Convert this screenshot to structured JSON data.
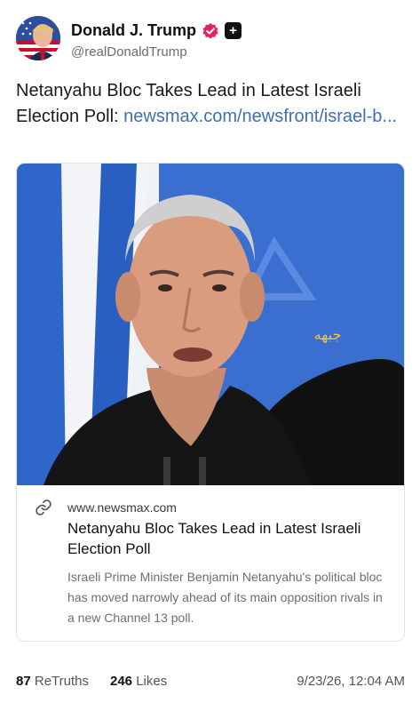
{
  "author": {
    "name": "Donald J. Trump",
    "handle": "@realDonaldTrump",
    "verified_color": "#e2245b"
  },
  "post": {
    "text": "Netanyahu Bloc Takes Lead in Latest Israeli Election Poll: ",
    "link": "newsmax.com/newsfront/israel-b..."
  },
  "card": {
    "image_watermark": "جبهه",
    "domain": "www.newsmax.com",
    "title": "Netanyahu Bloc Takes Lead in Latest Israeli Election Poll",
    "description": "Israeli Prime Minister Benjamin Netanyahu's political bloc has moved narrowly ahead of its main opposition rivals in a new Channel 13 poll."
  },
  "stats": {
    "retruths_count": "87",
    "retruths_label": "ReTruths",
    "likes_count": "246",
    "likes_label": "Likes",
    "timestamp": "9/23/26, 12:04 AM"
  },
  "icons": {
    "verified": "verified-badge-icon",
    "plus": "plus-badge-icon",
    "link": "link-icon"
  }
}
